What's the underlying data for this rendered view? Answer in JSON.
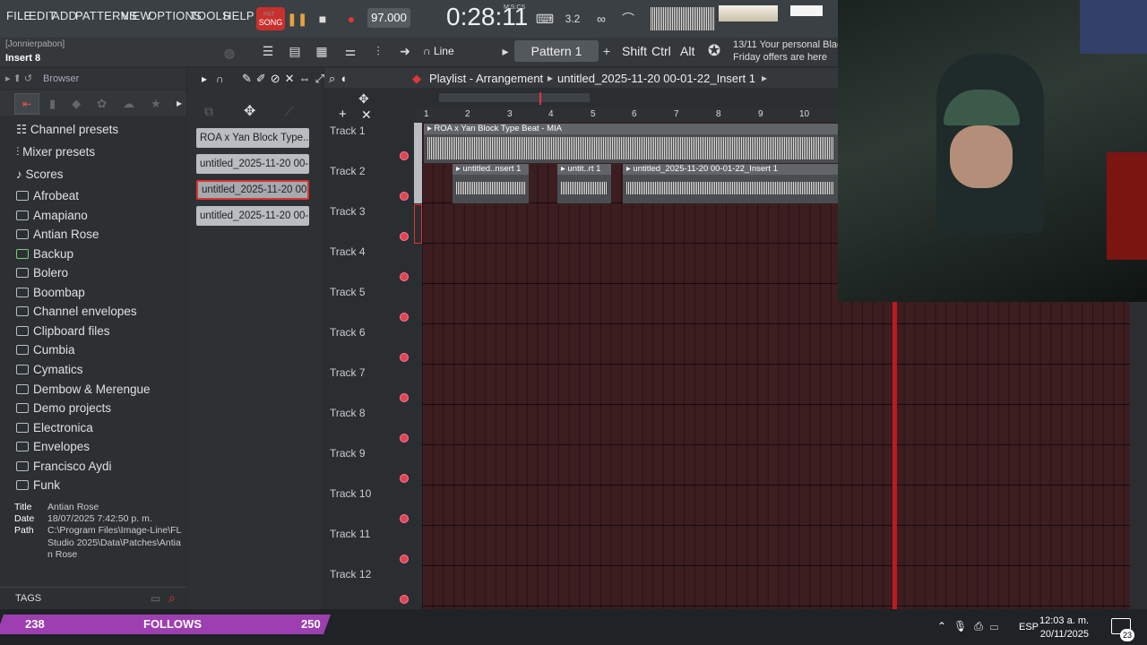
{
  "menu": [
    "FILE",
    "EDIT",
    "ADD",
    "PATTERNS",
    "VIEW",
    "OPTIONS",
    "TOOLS",
    "HELP"
  ],
  "transport": {
    "pat_label": "PAT",
    "song_label": "SONG",
    "tempo": "97.000",
    "time": "0:28:11",
    "time_unit": "M:S:CS"
  },
  "hint": {
    "line1": "[Jonnierpabon]",
    "line2": "Insert 8"
  },
  "toolbar2": {
    "snap": "Line",
    "pattern": "Pattern 1",
    "keys": [
      "Shift",
      "Ctrl",
      "Alt"
    ],
    "promo_line1": "13/11  Your personal Black",
    "promo_line2": "Friday offers are here"
  },
  "browser": {
    "title": "Browser",
    "items": [
      "Channel presets",
      "Mixer presets",
      "Scores",
      "Afrobeat",
      "Amapiano",
      "Antian Rose",
      "Backup",
      "Bolero",
      "Boombap",
      "Channel envelopes",
      "Clipboard files",
      "Cumbia",
      "Cymatics",
      "Dembow & Merengue",
      "Demo projects",
      "Electronica",
      "Envelopes",
      "Francisco Aydi",
      "Funk"
    ],
    "info": {
      "title_k": "Title",
      "title_v": "Antian Rose",
      "date_k": "Date",
      "date_v": "18/07/2025 7:42:50 p. m.",
      "path_k": "Path",
      "path_v": "C:\\Program Files\\Image-Line\\FL Studio 2025\\Data\\Patches\\Antian Rose"
    },
    "tags": "TAGS"
  },
  "patterns": [
    "ROA x Yan Block Type...",
    "untitled_2025-11-20 00-...",
    "untitled_2025-11-20 00-...",
    "untitled_2025-11-20 00-..."
  ],
  "playlist": {
    "title": "Playlist - Arrangement",
    "file": "untitled_2025-11-20 00-01-22_Insert 1",
    "bars": [
      "1",
      "2",
      "3",
      "4",
      "5",
      "6",
      "7",
      "8",
      "9",
      "10"
    ],
    "tracks": [
      "Track 1",
      "Track 2",
      "Track 3",
      "Track 4",
      "Track 5",
      "Track 6",
      "Track 7",
      "Track 8",
      "Track 9",
      "Track 10",
      "Track 11",
      "Track 12"
    ],
    "clips": {
      "c1": "ROA x Yan Block Type Beat - MIA",
      "c2": "untitled..nsert 1",
      "c3": "untit..rt 1",
      "c4": "untitled_2025-11-20 00-01-22_Insert 1"
    }
  },
  "stream": {
    "left": "238",
    "label": "FOLLOWS",
    "right": "250"
  },
  "system": {
    "lang": "ESP",
    "time": "12:03 a. m.",
    "date": "20/11/2025",
    "notif": "23"
  }
}
